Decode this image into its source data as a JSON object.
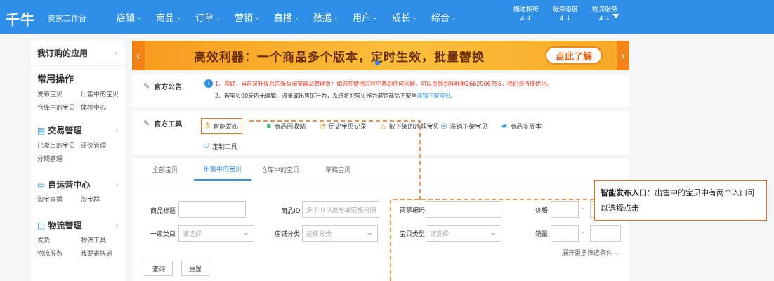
{
  "topbar": {
    "logo": "千牛",
    "subtitle": "卖家工作台",
    "nav": [
      "店铺",
      "商品",
      "订单",
      "营销",
      "直播",
      "数据",
      "用户",
      "成长",
      "综合"
    ],
    "metrics": [
      {
        "label": "描述相符",
        "value": "4 ↓"
      },
      {
        "label": "服务态度",
        "value": "4 ↓"
      },
      {
        "label": "物流服务",
        "value": "4 ↓"
      }
    ]
  },
  "sidebar": {
    "my_apps": "我订购的应用",
    "common_title": "常用操作",
    "common_links": [
      "发布宝贝",
      "出售中的宝贝",
      "仓库中的宝贝",
      "体检中心"
    ],
    "sections": [
      {
        "title": "交易管理",
        "icon": "receipt-icon",
        "links": [
          "已卖出的宝贝",
          "评价管理",
          "分期管理"
        ]
      },
      {
        "title": "自运营中心",
        "icon": "monitor-icon",
        "links": [
          "淘宝直播",
          "淘宝群"
        ]
      },
      {
        "title": "物流管理",
        "icon": "box-icon",
        "links": [
          "发货",
          "物流工具",
          "物流服务",
          "我要寄快递"
        ]
      }
    ]
  },
  "banner": {
    "text": "高效利器：一个商品多个版本，定时生效，批量替换",
    "button": "点此了解"
  },
  "notice": {
    "label": "官方公告",
    "line1": "1、您好，当前是升级后的新版淘宝商品管理页！如您在使用过程中遇到任何问题，可以反馈到旺旺群2662906756，我们会持续优化。",
    "line2_prefix": "2、若宝贝90天内无编辑、流量或出售的行为，系统将把宝贝作为滞销商品下架至",
    "line2_link": "滞销下架宝贝",
    "line2_suffix": "。"
  },
  "tools": {
    "label": "官方工具",
    "items": [
      "智能发布",
      "商品回收站",
      "历史宝贝记录",
      "被下架的违规宝贝",
      "滞销下架宝贝",
      "商品多版本"
    ],
    "second_row": "定制工具"
  },
  "list": {
    "tabs": [
      "全部宝贝",
      "出售中的宝贝",
      "仓库中的宝贝",
      "草稿宝贝"
    ],
    "filters": {
      "product_title": "商品标题",
      "product_id": "商品ID",
      "product_id_placeholder": "多个ID以逗号或空格分隔",
      "merchant_code": "商家编码",
      "price": "价格",
      "category": "一级类目",
      "category_placeholder": "请选择",
      "shop_category": "店铺分类",
      "shop_category_placeholder": "选择分类",
      "item_type": "宝贝类型",
      "item_type_placeholder": "请选择",
      "sales": "销量",
      "range_sep": "-",
      "more": "展开更多筛选条件"
    },
    "buttons": {
      "query": "查询",
      "reset": "重置"
    }
  },
  "callout": {
    "title": "智能发布入口",
    "text": "：出售中的宝贝中有两个入口可以选择点击"
  },
  "colors": {
    "brand": "#2f8fe6",
    "accent": "#e8701a",
    "warning": "#e8341c"
  }
}
